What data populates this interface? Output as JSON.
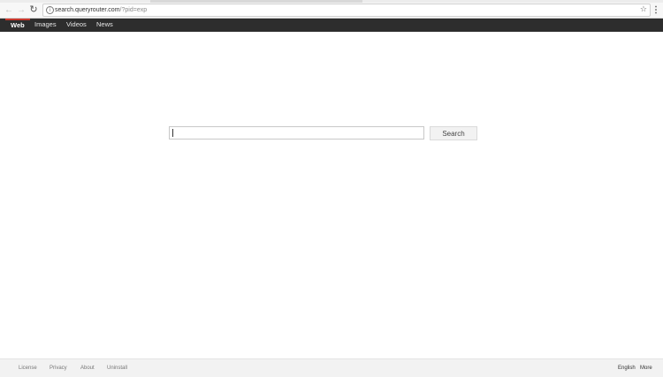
{
  "browser": {
    "url_host": "search.queryrouter.com",
    "url_path": "/?pid=exp",
    "icons": [
      "back-arrow-icon",
      "forward-arrow-icon",
      "reload-icon",
      "info-icon",
      "star-icon",
      "menu-icon"
    ]
  },
  "nav": {
    "items": [
      {
        "label": "Web",
        "active": true
      },
      {
        "label": "Images",
        "active": false
      },
      {
        "label": "Videos",
        "active": false
      },
      {
        "label": "News",
        "active": false
      }
    ],
    "active_color": "#c8372d",
    "bar_color": "#2d2d2d"
  },
  "search": {
    "value": "",
    "button_label": "Search"
  },
  "footer": {
    "links": [
      {
        "label": "License"
      },
      {
        "label": "Privacy"
      },
      {
        "label": "About"
      },
      {
        "label": "Uninstall"
      }
    ],
    "language": "English",
    "more": "More"
  }
}
